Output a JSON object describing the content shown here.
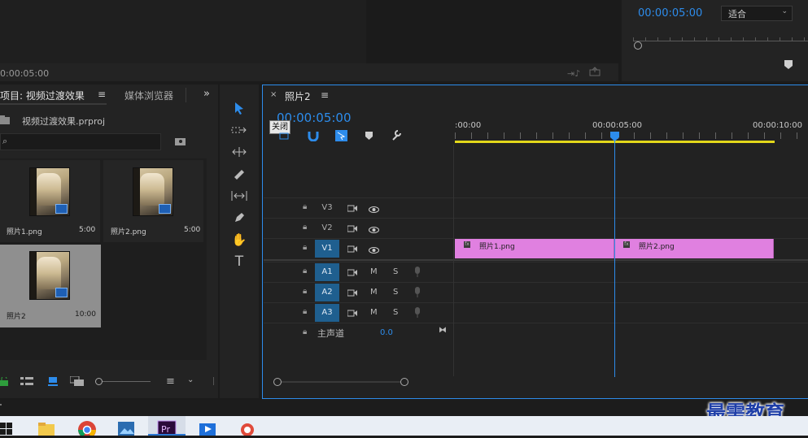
{
  "source_monitor": {
    "timecode": "0:00:05:00"
  },
  "program_monitor": {
    "timecode": "00:00:05:00",
    "zoom": "适合"
  },
  "project": {
    "tab_project": "项目: 视频过渡效果",
    "tab_media": "媒体浏览器",
    "file_name": "视频过渡效果.prproj",
    "search_placeholder": "",
    "items": [
      {
        "name": "照片1.png",
        "duration": "5:00"
      },
      {
        "name": "照片2.png",
        "duration": "5:00"
      },
      {
        "name": "照片2",
        "duration": "10:00"
      }
    ]
  },
  "timeline": {
    "tab_label": "照片2",
    "timecode": "00:00:05:00",
    "tooltip": "关闭",
    "ruler_labels": [
      ":00:00",
      "00:00:05:00",
      "00:00:10:00"
    ],
    "video_tracks": [
      "V3",
      "V2",
      "V1"
    ],
    "audio_tracks": [
      "A1",
      "A2",
      "A3"
    ],
    "mute": "M",
    "solo": "S",
    "master_label": "主声道",
    "master_value": "0.0",
    "clips": [
      {
        "name": "照片1.png"
      },
      {
        "name": "照片2.png"
      }
    ]
  },
  "watermark": "最需教育",
  "colors": {
    "accent": "#2d8ceb",
    "clip": "#e080e0",
    "work_area": "#e3d81a"
  }
}
